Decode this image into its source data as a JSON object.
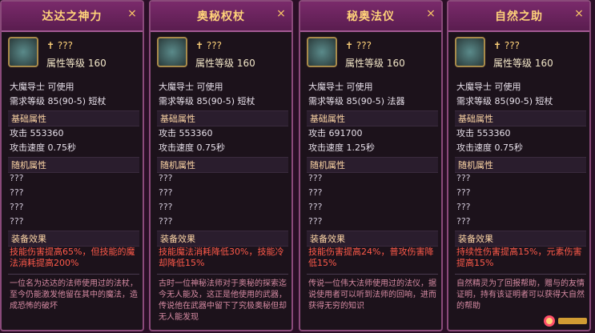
{
  "cards": [
    {
      "title": "达达之神力",
      "item_icon": "staff-icon",
      "req": "✝ ???",
      "level": "属性等级 160",
      "class": "大魔导士 可使用",
      "need": "需求等级 85(90-5) 短杖",
      "base_title": "基础属性",
      "atk": "攻击 553360",
      "spd": "攻击速度 0.75秒",
      "rand_title": "随机属性",
      "rand": [
        "???",
        "???",
        "???",
        "???"
      ],
      "equip_title": "装备效果",
      "effect": "技能伤害提高65%，但技能的魔法消耗提高200%",
      "lore": "一位名为达达的法师使用过的法杖，至今仍能激发他留在其中的魔法，造成恐怖的破坏"
    },
    {
      "title": "奥秘权杖",
      "item_icon": "staff-icon",
      "req": "✝ ???",
      "level": "属性等级 160",
      "class": "大魔导士 可使用",
      "need": "需求等级 85(90-5) 短杖",
      "base_title": "基础属性",
      "atk": "攻击 553360",
      "spd": "攻击速度 0.75秒",
      "rand_title": "随机属性",
      "rand": [
        "???",
        "???",
        "???",
        "???"
      ],
      "equip_title": "装备效果",
      "effect": "技能魔法消耗降低30%，技能冷却降低15%",
      "lore": "古时一位神秘法师对于奥秘的探索迄今无人能及，这正是他使用的武器，传说他在武器中留下了究极奥秘但却无人能发现"
    },
    {
      "title": "秘奥法仪",
      "item_icon": "magic-device-icon",
      "req": "✝ ???",
      "level": "属性等级 160",
      "class": "大魔导士 可使用",
      "need": "需求等级 85(90-5) 法器",
      "base_title": "基础属性",
      "atk": "攻击 691700",
      "spd": "攻击速度 1.25秒",
      "rand_title": "随机属性",
      "rand": [
        "???",
        "???",
        "???",
        "???"
      ],
      "equip_title": "装备效果",
      "effect": "技能伤害提高24%，普攻伤害降低15%",
      "lore": "传说一位伟大法师使用过的法仪，据说使用者可以听到法师的回响，进而获得无穷的知识"
    },
    {
      "title": "自然之助",
      "item_icon": "staff-icon",
      "req": "✝ ???",
      "level": "属性等级 160",
      "class": "大魔导士 可使用",
      "need": "需求等级 85(90-5) 短杖",
      "base_title": "基础属性",
      "atk": "攻击 553360",
      "spd": "攻击速度 0.75秒",
      "rand_title": "随机属性",
      "rand": [
        "???",
        "???",
        "???",
        "???"
      ],
      "equip_title": "装备效果",
      "effect": "持续性伤害提高15%，元素伤害提高15%",
      "lore": "自然精灵为了回报帮助，赠与的友情证明，持有该证明者可以获得大自然的帮助"
    }
  ]
}
